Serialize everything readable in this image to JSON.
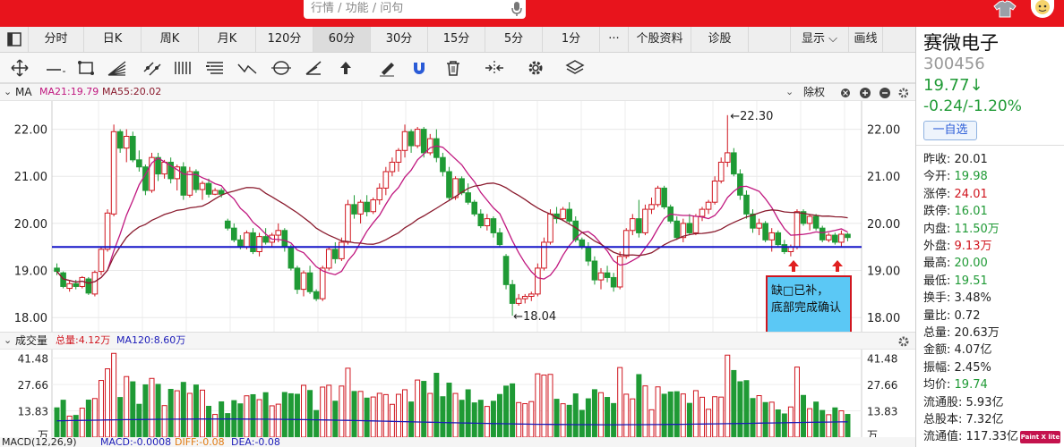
{
  "search": {
    "placeholder": "行情 / 功能 / 问句"
  },
  "tabs": [
    "分时",
    "日K",
    "周K",
    "月K",
    "120分",
    "60分",
    "30分",
    "15分",
    "5分",
    "1分",
    "···",
    "个股资料",
    "诊股"
  ],
  "selected_tab": "60分",
  "tab_right": {
    "display": "显示",
    "draw": "画线"
  },
  "ma_header": {
    "name": "MA",
    "ma21": "MA21:19.79",
    "ma55": "MA55:20.02",
    "adjust": "除权"
  },
  "y_ticks": [
    "22.00",
    "21.00",
    "20.00",
    "19.00",
    "18.00"
  ],
  "price_marks": {
    "high": "22.30",
    "low": "18.04"
  },
  "note_box": {
    "line1": "缺□已补，",
    "line2": "底部完成确认"
  },
  "vol_header": {
    "name": "成交量",
    "total": "总量:4.12万",
    "ma120": "MA120:8.60万"
  },
  "vol_ticks": [
    "41.48",
    "27.66",
    "13.83",
    "万"
  ],
  "macd_header": {
    "name": "MACD(12,26,9)",
    "macd": "MACD:-0.0008",
    "diff": "DIFF:-0.08",
    "dea": "DEA:-0.08"
  },
  "stock": {
    "name": "赛微电子",
    "code": "300456",
    "price": "19.77↓",
    "change": "-0.24/-1.20%",
    "watch_btn": "一自选"
  },
  "quote": [
    {
      "k": "昨收:",
      "v": "20.01",
      "c": "#222"
    },
    {
      "k": "今开:",
      "v": "19.98",
      "c": "#1f9a35"
    },
    {
      "k": "涨停:",
      "v": "24.01",
      "c": "#d0161f"
    },
    {
      "k": "跌停:",
      "v": "16.01",
      "c": "#1f9a35"
    },
    {
      "k": "内盘:",
      "v": "11.50万",
      "c": "#1f9a35"
    },
    {
      "k": "外盘:",
      "v": "9.13万",
      "c": "#d0161f"
    },
    {
      "k": "最高:",
      "v": "20.00",
      "c": "#1f9a35"
    },
    {
      "k": "最低:",
      "v": "19.51",
      "c": "#1f9a35"
    },
    {
      "k": "换手:",
      "v": "3.48%",
      "c": "#222"
    },
    {
      "k": "量比:",
      "v": "0.72",
      "c": "#222"
    },
    {
      "k": "总量:",
      "v": "20.63万",
      "c": "#222"
    },
    {
      "k": "金额:",
      "v": "4.07亿",
      "c": "#222"
    },
    {
      "k": "振幅:",
      "v": "2.45%",
      "c": "#222"
    },
    {
      "k": "均价:",
      "v": "19.74",
      "c": "#1f9a35"
    },
    {
      "k": "流通股:",
      "v": "5.93亿",
      "c": "#222"
    },
    {
      "k": "总股本:",
      "v": "7.32亿",
      "c": "#222"
    },
    {
      "k": "流通值:",
      "v": "117.33亿",
      "c": "#222"
    }
  ],
  "watermark": "Paint X lite",
  "colors": {
    "up": "#d0161f",
    "down": "#1f9a35",
    "ma21": "#c0177f",
    "ma55": "#8a1b2e",
    "support": "#1515c8",
    "vol_ma": "#1a1ab8",
    "note_bg": "#5bc8f5",
    "note_border": "#d0161f"
  },
  "chart_data": {
    "type": "candlestick",
    "y_range": [
      17.7,
      22.6
    ],
    "candles_ohlc": [
      [
        19.05,
        19.15,
        18.9,
        18.98
      ],
      [
        18.95,
        18.98,
        18.62,
        18.66
      ],
      [
        18.62,
        18.78,
        18.55,
        18.72
      ],
      [
        18.72,
        18.8,
        18.6,
        18.66
      ],
      [
        18.66,
        18.88,
        18.62,
        18.85
      ],
      [
        18.82,
        18.86,
        18.48,
        18.52
      ],
      [
        18.5,
        19.0,
        18.45,
        18.96
      ],
      [
        18.98,
        19.5,
        18.9,
        19.45
      ],
      [
        19.45,
        20.3,
        19.4,
        20.22
      ],
      [
        20.2,
        22.1,
        20.15,
        21.95
      ],
      [
        21.95,
        22.0,
        21.5,
        21.6
      ],
      [
        21.6,
        22.0,
        21.3,
        21.85
      ],
      [
        21.85,
        21.95,
        21.3,
        21.35
      ],
      [
        21.35,
        21.55,
        21.1,
        21.2
      ],
      [
        21.2,
        21.25,
        20.6,
        20.7
      ],
      [
        20.7,
        21.5,
        20.65,
        21.4
      ],
      [
        21.4,
        21.5,
        20.9,
        21.05
      ],
      [
        21.05,
        21.35,
        20.95,
        21.3
      ],
      [
        21.3,
        21.4,
        20.85,
        20.95
      ],
      [
        20.95,
        21.25,
        20.7,
        21.2
      ],
      [
        21.2,
        21.3,
        20.5,
        20.6
      ],
      [
        20.6,
        21.2,
        20.55,
        21.1
      ],
      [
        21.1,
        21.15,
        20.65,
        20.72
      ],
      [
        20.72,
        20.9,
        20.5,
        20.85
      ],
      [
        20.85,
        20.95,
        20.55,
        20.62
      ],
      [
        20.62,
        20.75,
        20.6,
        20.7
      ],
      [
        20.7,
        20.75,
        20.55,
        20.62
      ],
      [
        20.05,
        20.1,
        19.85,
        19.9
      ],
      [
        19.9,
        20.0,
        19.6,
        19.65
      ],
      [
        19.65,
        19.75,
        19.45,
        19.5
      ],
      [
        19.5,
        19.85,
        19.45,
        19.8
      ],
      [
        19.8,
        19.9,
        19.35,
        19.4
      ],
      [
        19.4,
        19.8,
        19.3,
        19.72
      ],
      [
        19.72,
        19.9,
        19.55,
        19.6
      ],
      [
        19.6,
        19.8,
        19.5,
        19.75
      ],
      [
        19.75,
        20.0,
        19.6,
        19.85
      ],
      [
        19.85,
        19.9,
        19.4,
        19.5
      ],
      [
        19.5,
        19.55,
        19.0,
        19.05
      ],
      [
        19.05,
        19.1,
        18.5,
        18.6
      ],
      [
        18.6,
        19.0,
        18.45,
        18.95
      ],
      [
        18.95,
        19.1,
        18.5,
        18.55
      ],
      [
        18.55,
        18.6,
        18.35,
        18.4
      ],
      [
        18.4,
        19.1,
        18.35,
        19.05
      ],
      [
        19.05,
        19.5,
        19.0,
        19.45
      ],
      [
        19.45,
        19.6,
        19.15,
        19.25
      ],
      [
        19.25,
        19.7,
        19.2,
        19.6
      ],
      [
        19.6,
        20.5,
        19.55,
        20.4
      ],
      [
        20.4,
        20.6,
        20.1,
        20.2
      ],
      [
        20.2,
        20.5,
        20.0,
        20.45
      ],
      [
        20.45,
        20.6,
        20.15,
        20.25
      ],
      [
        20.25,
        20.55,
        20.2,
        20.5
      ],
      [
        20.5,
        20.85,
        20.4,
        20.75
      ],
      [
        20.75,
        21.2,
        20.6,
        21.1
      ],
      [
        21.1,
        21.4,
        21.0,
        21.3
      ],
      [
        21.3,
        21.6,
        21.1,
        21.55
      ],
      [
        21.55,
        22.1,
        21.4,
        21.95
      ],
      [
        21.95,
        22.0,
        21.5,
        21.65
      ],
      [
        21.65,
        22.05,
        21.6,
        22.0
      ],
      [
        22.0,
        22.05,
        21.4,
        21.5
      ],
      [
        21.5,
        21.9,
        21.45,
        21.8
      ],
      [
        21.8,
        22.0,
        21.3,
        21.4
      ],
      [
        21.4,
        21.5,
        21.0,
        21.1
      ],
      [
        21.1,
        21.2,
        20.5,
        20.55
      ],
      [
        20.55,
        21.0,
        20.5,
        20.95
      ],
      [
        20.95,
        21.0,
        20.6,
        20.65
      ],
      [
        20.65,
        20.85,
        20.4,
        20.45
      ],
      [
        20.45,
        20.5,
        20.15,
        20.2
      ],
      [
        20.2,
        20.3,
        19.9,
        19.95
      ],
      [
        19.95,
        20.2,
        19.85,
        20.1
      ],
      [
        20.1,
        20.15,
        19.7,
        19.8
      ],
      [
        19.8,
        19.9,
        19.5,
        19.55
      ],
      [
        19.3,
        19.35,
        18.6,
        18.7
      ],
      [
        18.7,
        18.8,
        18.04,
        18.3
      ],
      [
        18.3,
        18.5,
        18.25,
        18.4
      ],
      [
        18.4,
        18.5,
        18.3,
        18.45
      ],
      [
        18.45,
        18.55,
        18.35,
        18.5
      ],
      [
        18.5,
        19.15,
        18.45,
        19.05
      ],
      [
        19.05,
        19.7,
        19.0,
        19.6
      ],
      [
        19.6,
        20.3,
        19.55,
        20.2
      ],
      [
        20.2,
        20.35,
        20.0,
        20.1
      ],
      [
        20.1,
        20.35,
        20.05,
        20.3
      ],
      [
        20.3,
        20.45,
        20.0,
        20.05
      ],
      [
        20.05,
        20.15,
        19.6,
        19.65
      ],
      [
        19.65,
        19.7,
        19.45,
        19.5
      ],
      [
        19.5,
        19.6,
        19.1,
        19.2
      ],
      [
        19.2,
        19.3,
        18.7,
        18.8
      ],
      [
        18.8,
        19.05,
        18.6,
        18.95
      ],
      [
        18.95,
        19.1,
        18.75,
        18.85
      ],
      [
        18.85,
        18.95,
        18.55,
        18.65
      ],
      [
        18.65,
        19.4,
        18.6,
        19.3
      ],
      [
        19.3,
        19.9,
        19.25,
        19.85
      ],
      [
        19.85,
        20.2,
        19.75,
        20.1
      ],
      [
        20.1,
        20.5,
        19.7,
        19.8
      ],
      [
        19.8,
        20.4,
        19.75,
        20.3
      ],
      [
        20.3,
        20.55,
        20.2,
        20.4
      ],
      [
        20.4,
        20.8,
        20.35,
        20.75
      ],
      [
        20.75,
        20.8,
        20.3,
        20.35
      ],
      [
        20.35,
        20.4,
        20.0,
        20.05
      ],
      [
        20.05,
        20.15,
        19.65,
        19.7
      ],
      [
        19.7,
        20.1,
        19.6,
        20.0
      ],
      [
        20.0,
        20.2,
        19.75,
        19.8
      ],
      [
        19.8,
        20.2,
        19.75,
        20.15
      ],
      [
        20.15,
        20.35,
        20.05,
        20.3
      ],
      [
        20.3,
        20.5,
        20.2,
        20.45
      ],
      [
        20.45,
        21.0,
        20.4,
        20.9
      ],
      [
        20.9,
        21.4,
        20.85,
        21.3
      ],
      [
        21.3,
        22.3,
        21.2,
        21.5
      ],
      [
        21.5,
        21.6,
        21.0,
        21.05
      ],
      [
        21.05,
        21.15,
        20.5,
        20.6
      ],
      [
        20.6,
        20.7,
        20.1,
        20.2
      ],
      [
        20.2,
        20.3,
        19.8,
        19.9
      ],
      [
        19.9,
        20.1,
        19.75,
        20.0
      ],
      [
        20.0,
        20.05,
        19.6,
        19.65
      ],
      [
        19.65,
        19.9,
        19.4,
        19.8
      ],
      [
        19.8,
        19.85,
        19.5,
        19.55
      ],
      [
        19.55,
        19.65,
        19.35,
        19.4
      ],
      [
        19.4,
        19.55,
        19.3,
        19.5
      ],
      [
        19.5,
        20.3,
        19.45,
        20.25
      ],
      [
        20.25,
        20.3,
        19.95,
        20.0
      ],
      [
        20.0,
        20.2,
        19.85,
        20.15
      ],
      [
        20.15,
        20.2,
        19.85,
        19.9
      ],
      [
        19.9,
        19.95,
        19.6,
        19.65
      ],
      [
        19.65,
        19.8,
        19.6,
        19.75
      ],
      [
        19.75,
        19.8,
        19.55,
        19.6
      ],
      [
        19.6,
        19.85,
        19.51,
        19.77
      ],
      [
        19.77,
        19.8,
        19.62,
        19.7
      ]
    ],
    "support_line": 19.5,
    "volume_ticks": [
      41.48,
      27.66,
      13.83
    ],
    "volume_unit": "万"
  }
}
